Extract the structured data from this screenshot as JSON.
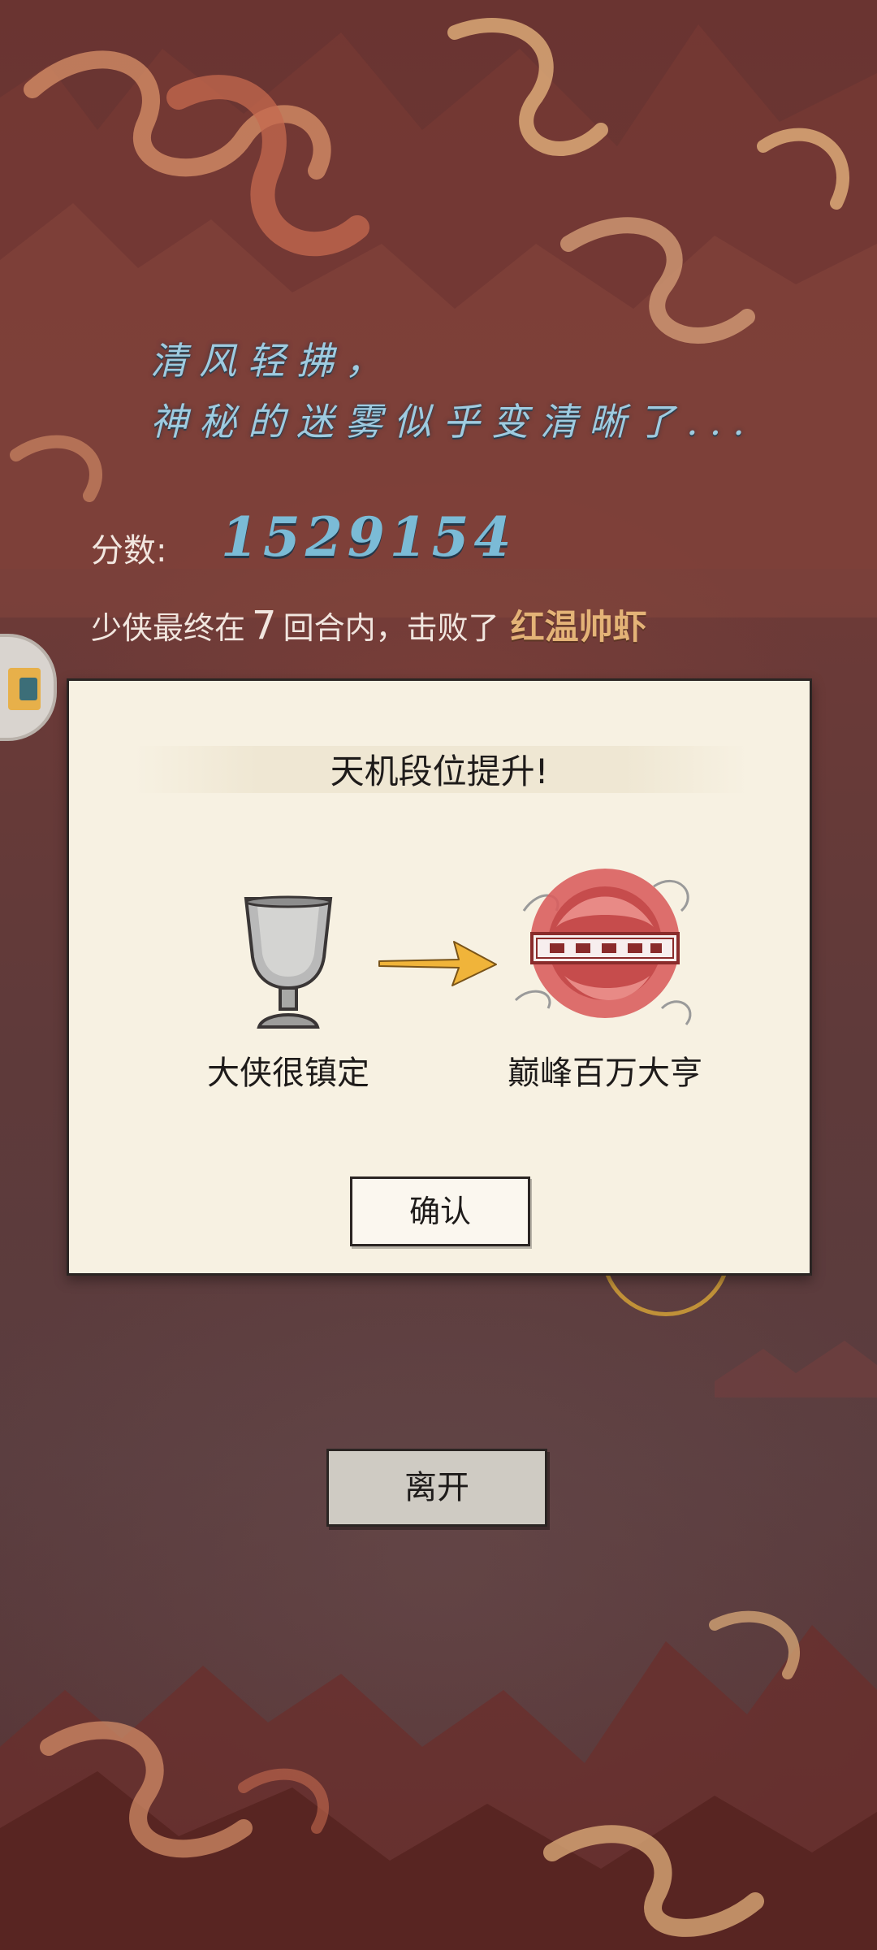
{
  "poem": {
    "line1": "清风轻拂，",
    "line2": "神秘的迷雾似乎变清晰了..."
  },
  "score": {
    "label": "分数:",
    "value": "1529154"
  },
  "result": {
    "prefix": "少侠最终在",
    "rounds": "7",
    "middle": "回合内，击败了",
    "boss": "红温帅虾"
  },
  "modal": {
    "title": "天机段位提升!",
    "from_rank": "大侠很镇定",
    "to_rank": "巅峰百万大亨",
    "confirm_label": "确认"
  },
  "leave_label": "离开",
  "colors": {
    "poem_text": "#9ecbe0",
    "score_value": "#7bbbd6",
    "boss_name": "#e4b377",
    "panel_bg": "#f7f1e2",
    "arrow": "#f0b43a"
  },
  "icons": {
    "from_rank_icon": "silver-goblet-icon",
    "to_rank_icon": "red-dragon-seal-icon",
    "arrow": "right-arrow-icon"
  }
}
